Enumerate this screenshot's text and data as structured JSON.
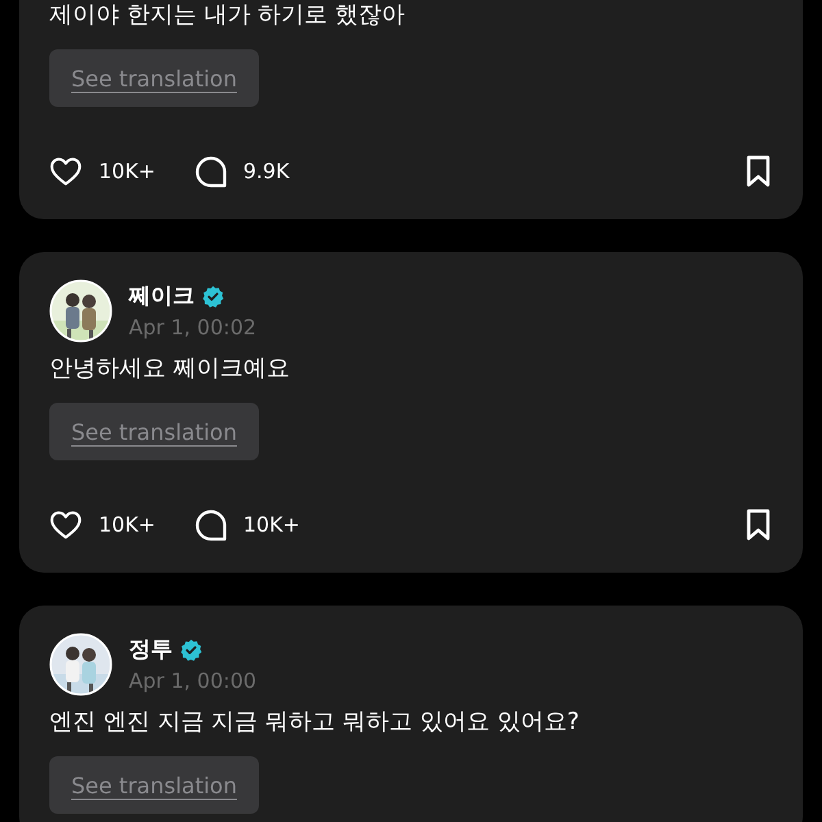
{
  "posts": [
    {
      "text": "제이야 한지는 내가 하기로 했잖아",
      "translate": "See translation",
      "likes": "10K+",
      "comments": "9.9K"
    },
    {
      "author": "쩨이크",
      "verified": true,
      "date": "Apr 1, 00:02",
      "text": "안녕하세요 쩨이크예요",
      "translate": "See translation",
      "likes": "10K+",
      "comments": "10K+"
    },
    {
      "author": "정투",
      "verified": true,
      "date": "Apr 1, 00:00",
      "text": "엔진 엔진 지금 지금 뭐하고 뭐하고 있어요 있어요?",
      "translate": "See translation"
    }
  ]
}
